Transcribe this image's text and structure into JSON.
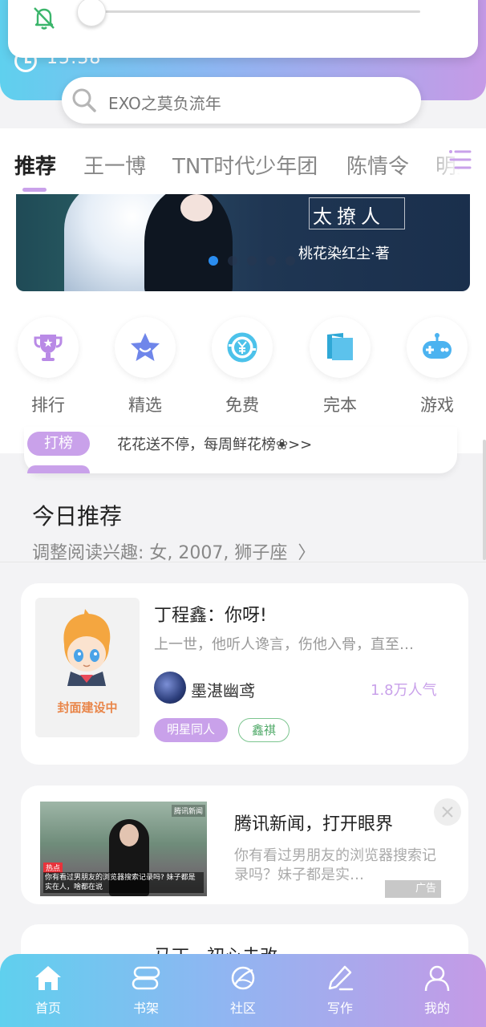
{
  "status": {
    "time": "15:38"
  },
  "search": {
    "placeholder": "EXO之莫负流年"
  },
  "tabs": [
    {
      "label": "推荐"
    },
    {
      "label": "王一博"
    },
    {
      "label": "TNT时代少年团"
    },
    {
      "label": "陈情令"
    },
    {
      "label": "明星"
    }
  ],
  "banner": {
    "title": "太撩人",
    "author": "桃花染红尘·著",
    "active_slide": 1,
    "slide_count": 5
  },
  "categories": [
    {
      "label": "排行",
      "icon": "trophy-icon"
    },
    {
      "label": "精选",
      "icon": "star-icon"
    },
    {
      "label": "免费",
      "icon": "yen-coin-icon"
    },
    {
      "label": "完本",
      "icon": "book-icon"
    },
    {
      "label": "游戏",
      "icon": "gamepad-icon"
    }
  ],
  "notice": {
    "badge": "打榜",
    "text": "花花送不停，每周鲜花榜❀>>"
  },
  "today": {
    "title": "今日推荐",
    "subtitle": "调整阅读兴趣: 女, 2007, 狮子座"
  },
  "book": {
    "cover_text": "封面建设中",
    "title": "丁程鑫：你呀!",
    "description": "上一世，他听人谗言，伤他入骨，直至…",
    "author": "墨湛幽鸢",
    "popularity": "1.8万人气",
    "tags": [
      "明星同人",
      "鑫祺"
    ]
  },
  "ad": {
    "logo": "腾讯新闻",
    "image_badge": "热点",
    "image_caption": "你有看过男朋友的浏览器搜索记录吗? 妹子都是实在人，啥都在说",
    "title": "腾讯新闻，打开眼界",
    "description": "你有看过男朋友的浏览器搜索记录吗？妹子都是实…",
    "badge": "广告"
  },
  "next_card": {
    "title": "马丁一初心未改"
  },
  "bottom_nav": [
    {
      "label": "首页",
      "icon": "home-icon"
    },
    {
      "label": "书架",
      "icon": "bookshelf-icon"
    },
    {
      "label": "社区",
      "icon": "planet-icon"
    },
    {
      "label": "写作",
      "icon": "pen-icon"
    },
    {
      "label": "我的",
      "icon": "user-icon"
    }
  ],
  "colors": {
    "accent": "#c9a1ea",
    "gradient_start": "#5fd0ee",
    "gradient_end": "#c59ae6",
    "tag_green": "#4da866"
  }
}
